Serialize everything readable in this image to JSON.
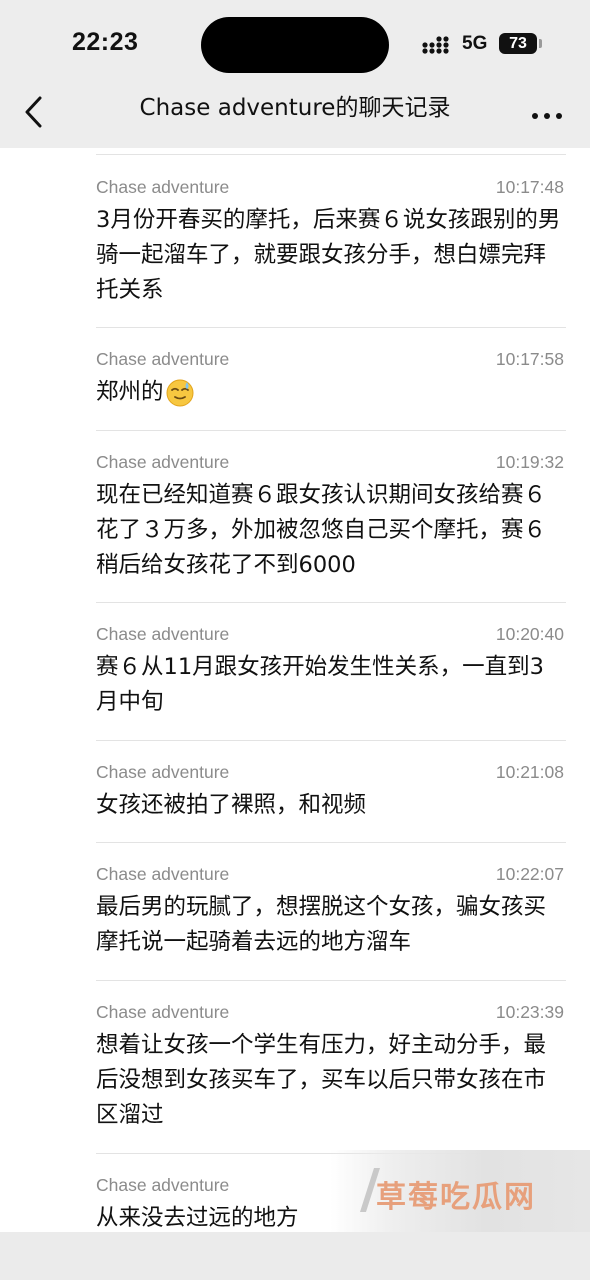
{
  "status_bar": {
    "time": "22:23",
    "network": "5G",
    "battery": "73"
  },
  "nav": {
    "title": "Chase adventure的聊天记录"
  },
  "messages": [
    {
      "sender": "Chase adventure",
      "time": "10:17:48",
      "text": "3月份开春买的摩托，后来赛６说女孩跟别的男骑一起溜车了，就要跟女孩分手，想白嫖完拜托关系"
    },
    {
      "sender": "Chase adventure",
      "time": "10:17:58",
      "text": "郑州的",
      "emoji": "sweat-smile-emoji"
    },
    {
      "sender": "Chase adventure",
      "time": "10:19:32",
      "text": "现在已经知道赛６跟女孩认识期间女孩给赛６花了３万多，外加被忽悠自己买个摩托，赛６稍后给女孩花了不到6000"
    },
    {
      "sender": "Chase adventure",
      "time": "10:20:40",
      "text": "赛６从11月跟女孩开始发生性关系，一直到3月中旬"
    },
    {
      "sender": "Chase adventure",
      "time": "10:21:08",
      "text": "女孩还被拍了裸照，和视频"
    },
    {
      "sender": "Chase adventure",
      "time": "10:22:07",
      "text": "最后男的玩腻了，想摆脱这个女孩，骗女孩买摩托说一起骑着去远的地方溜车"
    },
    {
      "sender": "Chase adventure",
      "time": "10:23:39",
      "text": "想着让女孩一个学生有压力，好主动分手，最后没想到女孩买车了，买车以后只带女孩在市区溜过"
    },
    {
      "sender": "Chase adventure",
      "time": "",
      "text": "从来没去过远的地方"
    }
  ],
  "watermark": {
    "text": "草莓吃瓜网"
  }
}
